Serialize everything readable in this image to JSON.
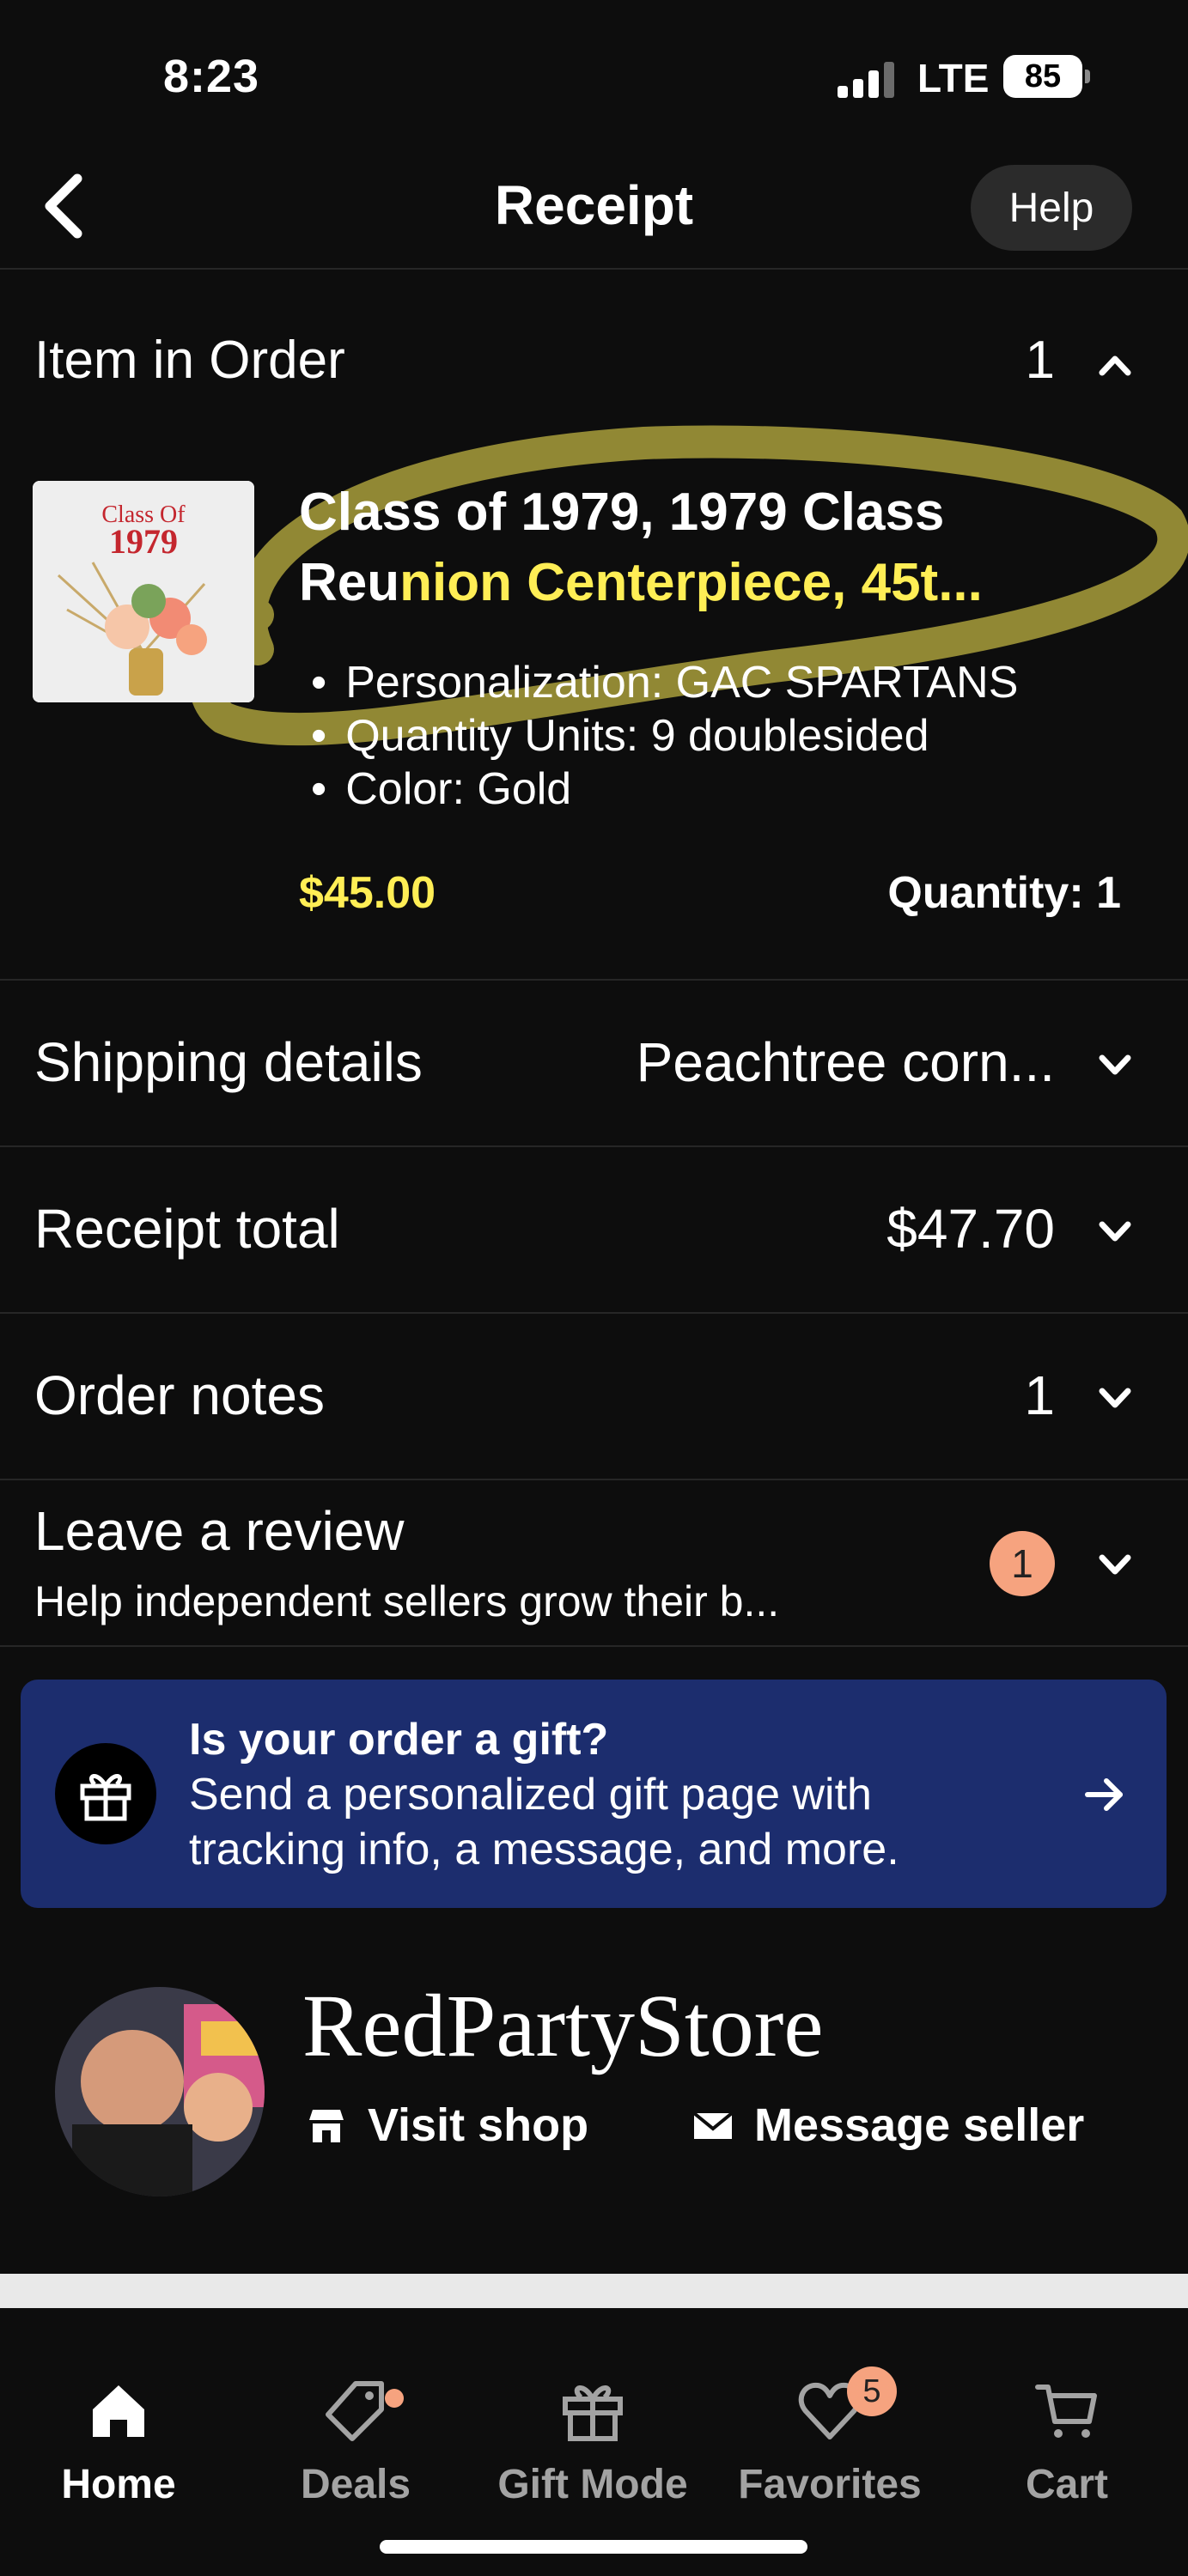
{
  "status_bar": {
    "time": "8:23",
    "network": "LTE",
    "battery": "85"
  },
  "header": {
    "title": "Receipt",
    "help_label": "Help"
  },
  "items_section": {
    "title": "Item in Order",
    "count": "1",
    "item": {
      "title_line1": "Class of 1979, 1979 Class",
      "title_line2_plain": "Reu",
      "title_line2_highlight": "nion Centerpiece, 45t...",
      "thumbnail_caption_line1": "Class Of",
      "thumbnail_caption_line2": "1979",
      "attributes": [
        "Personalization:  GAC SPARTANS",
        "Quantity Units: 9 doublesided",
        "Color: Gold"
      ],
      "price": "$45.00",
      "quantity": "Quantity: 1"
    }
  },
  "shipping": {
    "label": "Shipping details",
    "value": "Peachtree corn..."
  },
  "receipt_total": {
    "label": "Receipt total",
    "value": "$47.70"
  },
  "order_notes": {
    "label": "Order notes",
    "value": "1"
  },
  "review": {
    "title": "Leave a review",
    "subtitle": "Help independent sellers grow their b...",
    "badge": "1"
  },
  "gift_banner": {
    "title": "Is your order a gift?",
    "line2": "Send a personalized gift page with",
    "line3": "tracking info, a message, and more."
  },
  "shop": {
    "name": "RedPartyStore",
    "visit_label": "Visit shop",
    "message_label": "Message seller"
  },
  "tabs": [
    {
      "label": "Home",
      "icon": "home-icon",
      "active": true
    },
    {
      "label": "Deals",
      "icon": "tag-icon"
    },
    {
      "label": "Gift Mode",
      "icon": "gift-icon"
    },
    {
      "label": "Favorites",
      "icon": "heart-icon",
      "badge": "5"
    },
    {
      "label": "Cart",
      "icon": "cart-icon"
    }
  ],
  "colors": {
    "background": "#0d0d0d",
    "highlight": "#ffee55",
    "accent": "#f6a37f",
    "gift_banner": "#1c2d6e"
  }
}
